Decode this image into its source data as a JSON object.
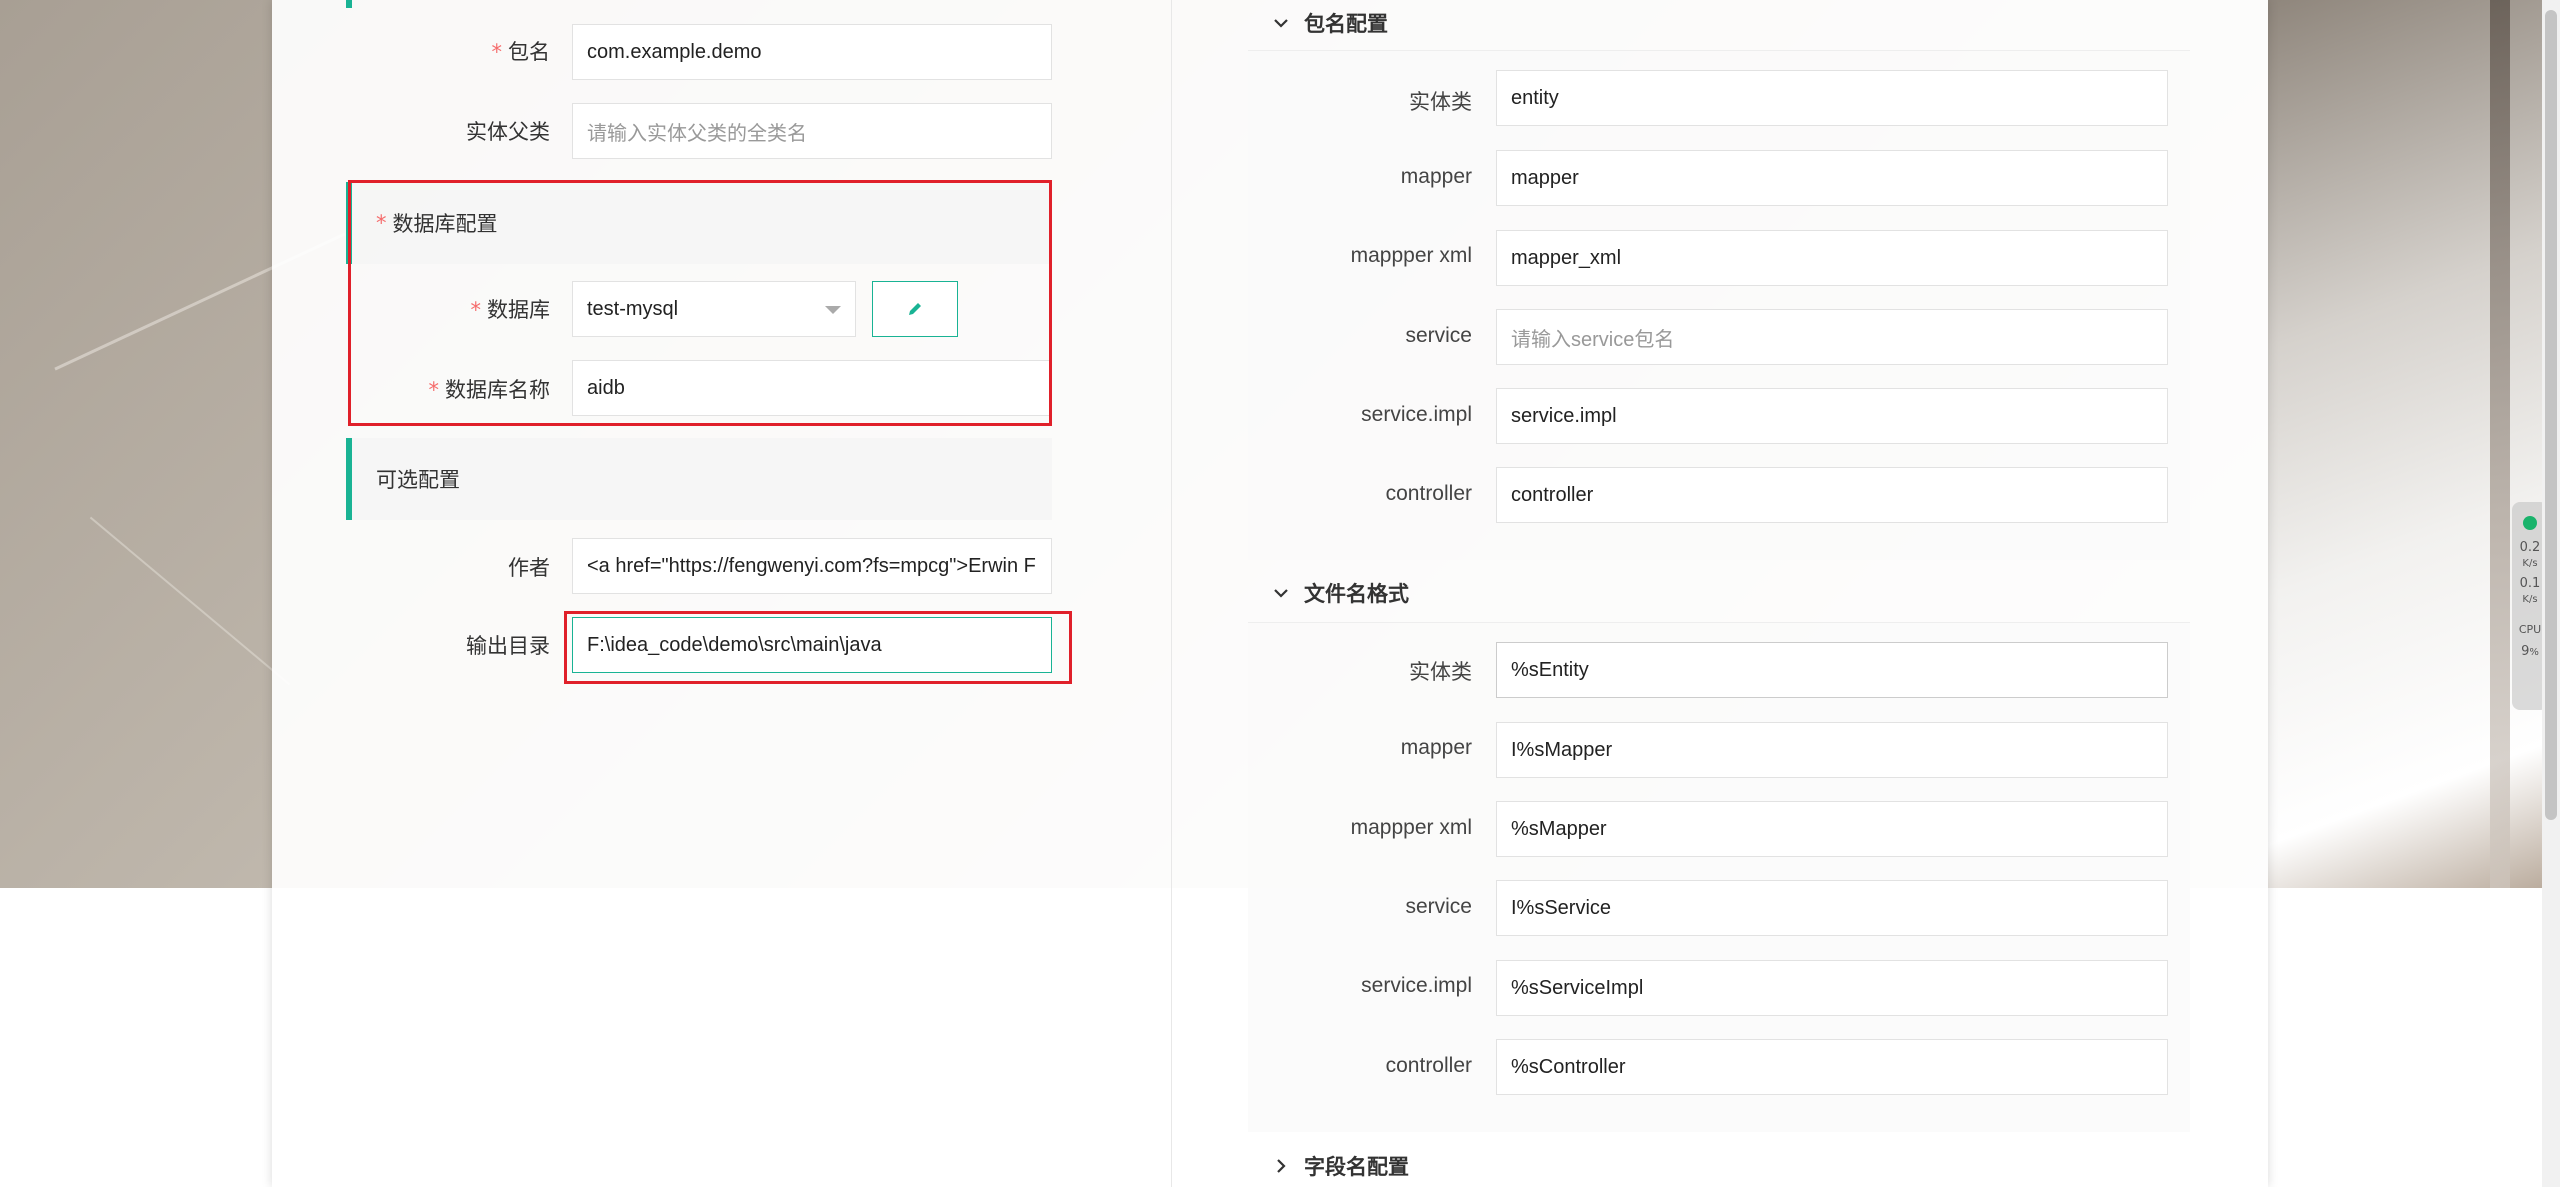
{
  "left_form": {
    "package_label": "包名",
    "package_value": "com.example.demo",
    "entity_parent_label": "实体父类",
    "entity_parent_placeholder": "请输入实体父类的全类名",
    "db_section_title": "数据库配置",
    "database_label": "数据库",
    "database_value": "test-mysql",
    "db_name_label": "数据库名称",
    "db_name_value": "aidb",
    "optional_section_title": "可选配置",
    "author_label": "作者",
    "author_value": "<a href=\"https://fengwenyi.com?fs=mpcg\">Erwin F",
    "output_dir_label": "输出目录",
    "output_dir_value": "F:\\idea_code\\demo\\src\\main\\java"
  },
  "package_config": {
    "title": "包名配置",
    "items": [
      {
        "label": "实体类",
        "value": "entity",
        "placeholder": ""
      },
      {
        "label": "mapper",
        "value": "mapper",
        "placeholder": ""
      },
      {
        "label": "mappper xml",
        "value": "mapper_xml",
        "placeholder": ""
      },
      {
        "label": "service",
        "value": "",
        "placeholder": "请输入service包名"
      },
      {
        "label": "service.impl",
        "value": "service.impl",
        "placeholder": ""
      },
      {
        "label": "controller",
        "value": "controller",
        "placeholder": ""
      }
    ]
  },
  "filename_format": {
    "title": "文件名格式",
    "items": [
      {
        "label": "实体类",
        "value": "%sEntity"
      },
      {
        "label": "mapper",
        "value": "I%sMapper"
      },
      {
        "label": "mappper xml",
        "value": "%sMapper"
      },
      {
        "label": "service",
        "value": "I%sService"
      },
      {
        "label": "service.impl",
        "value": "%sServiceImpl"
      },
      {
        "label": "controller",
        "value": "%sController"
      }
    ]
  },
  "field_name_config": {
    "title": "字段名配置"
  },
  "net_monitor": {
    "up": "0.2",
    "up_unit": "K/s",
    "down": "0.1",
    "down_unit": "K/s",
    "cpu_label": "CPU",
    "cpu_value": "9",
    "cpu_unit": "%"
  },
  "colors": {
    "accent": "#19b394",
    "required": "#f56c6c",
    "highlight": "#e0202a"
  }
}
